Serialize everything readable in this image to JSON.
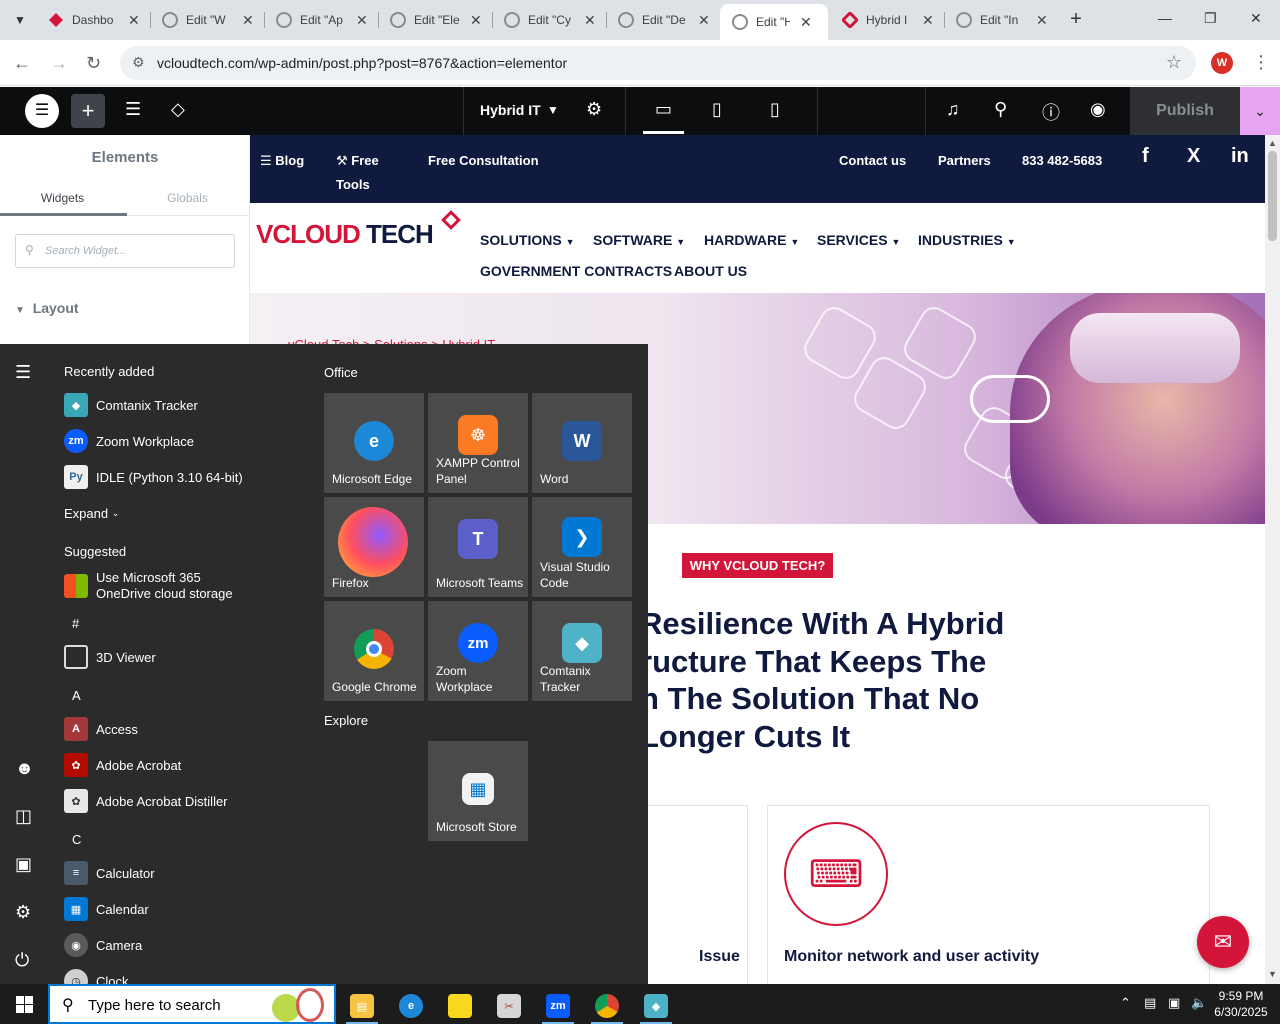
{
  "browser": {
    "tabs": [
      {
        "title": "Dashbo",
        "icon": "wp-red-icon"
      },
      {
        "title": "Edit \"W",
        "icon": "wordpress-icon"
      },
      {
        "title": "Edit \"Ap",
        "icon": "wordpress-icon"
      },
      {
        "title": "Edit \"Ele",
        "icon": "wordpress-icon"
      },
      {
        "title": "Edit \"Cy",
        "icon": "wordpress-icon"
      },
      {
        "title": "Edit \"De",
        "icon": "wordpress-icon"
      },
      {
        "title": "Edit \"Hy",
        "icon": "wordpress-icon",
        "active": true
      },
      {
        "title": "Hybrid I",
        "icon": "vcloud-red-icon"
      },
      {
        "title": "Edit \"In",
        "icon": "wordpress-icon"
      }
    ],
    "url": "vcloudtech.com/wp-admin/post.php?post=8767&action=elementor",
    "profile_initial": "W"
  },
  "elementor": {
    "document_title": "Hybrid IT",
    "publish_label": "Publish",
    "panel": {
      "title": "Elements",
      "tabs": [
        "Widgets",
        "Globals"
      ],
      "search_placeholder": "Search Widget...",
      "category": "Layout"
    }
  },
  "site": {
    "topnav": {
      "blog": "Blog",
      "free_tools": "Free Tools",
      "free_consultation": "Free Consultation",
      "contact": "Contact us",
      "partners": "Partners",
      "phone": "833 482-5683"
    },
    "logo": {
      "part1": "VCLOUD",
      "part2": "TECH"
    },
    "mainnav": [
      "SOLUTIONS",
      "SOFTWARE",
      "HARDWARE",
      "SERVICES",
      "INDUSTRIES",
      "GOVERNMENT CONTRACTS",
      "ABOUT US"
    ],
    "breadcrumb": "vCloud Tech  >  Solutions  >  Hybrid IT",
    "badge": "WHY VCLOUD TECH?",
    "heading_lines": [
      "Resilience With A Hybrid",
      "ructure That Keeps The",
      "n The Solution That No",
      "Longer Cuts It"
    ],
    "cards": [
      {
        "title": "Issue"
      },
      {
        "title": "Monitor network and user activity"
      }
    ]
  },
  "start_menu": {
    "recently_added_label": "Recently added",
    "recent": [
      "Comtanix Tracker",
      "Zoom Workplace",
      "IDLE (Python 3.10 64-bit)"
    ],
    "expand_label": "Expand",
    "suggested_label": "Suggested",
    "suggested": [
      "Use Microsoft 365",
      "OneDrive cloud storage"
    ],
    "letters": [
      "#",
      "A",
      "C"
    ],
    "apps_hash": [
      "3D Viewer"
    ],
    "apps_a": [
      "Access",
      "Adobe Acrobat",
      "Adobe Acrobat Distiller"
    ],
    "apps_c": [
      "Calculator",
      "Calendar",
      "Camera",
      "Clock"
    ],
    "office_label": "Office",
    "explore_label": "Explore",
    "tiles": [
      {
        "label": "Microsoft Edge",
        "color": "#1e88d8"
      },
      {
        "label": "XAMPP Control Panel",
        "color": "#fb7a24"
      },
      {
        "label": "Word",
        "color": "#2b579a"
      },
      {
        "label": "Firefox",
        "color": "#ff7139"
      },
      {
        "label": "Microsoft Teams",
        "color": "#5b5fc7"
      },
      {
        "label": "Visual Studio Code",
        "color": "#0078d4"
      },
      {
        "label": "Google Chrome",
        "color": "#db4437"
      },
      {
        "label": "Zoom Workplace",
        "color": "#0b5cff"
      },
      {
        "label": "Comtanix Tracker",
        "color": "#4fb3c8"
      }
    ],
    "explore_tiles": [
      {
        "label": "Microsoft Store",
        "color": "#f2f2f2"
      }
    ]
  },
  "taskbar": {
    "search_placeholder": "Type here to search",
    "time": "9:59 PM",
    "date": "6/30/2025"
  }
}
